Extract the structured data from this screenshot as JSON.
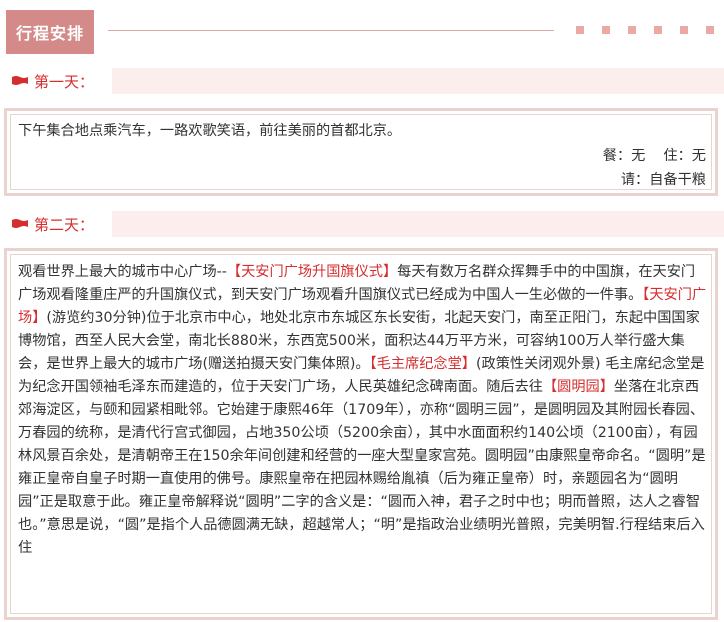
{
  "header": {
    "title": "行程安排"
  },
  "day1": {
    "label": "第一天：",
    "description": "下午集合地点乘汽车，一路欢歌笑语，前往美丽的首都北京。",
    "meals": "餐：无",
    "stay": "住：无",
    "note": "请：自备干粮"
  },
  "day2": {
    "label": "第二天：",
    "segments": [
      {
        "text": "观看世界上最大的城市中心广场--",
        "highlight": false
      },
      {
        "text": "【天安门广场升国旗仪式】",
        "highlight": true
      },
      {
        "text": "每天有数万名群众挥舞手中的中国旗，在天安门广场观看隆重庄严的升国旗仪式，到天安门广场观看升国旗仪式已经成为中国人一生必做的一件事。",
        "highlight": false
      },
      {
        "text": "【天安门广场】",
        "highlight": true
      },
      {
        "text": "(游览约30分钟)位于北京市中心，地处北京市东城区东长安街，北起天安门，南至正阳门，东起中国国家博物馆，西至人民大会堂，南北长880米，东西宽500米，面积达44万平方米，可容纳100万人举行盛大集会，是世界上最大的城市广场(赠送拍摄天安门集体照)。",
        "highlight": false
      },
      {
        "text": "【毛主席纪念堂】",
        "highlight": true
      },
      {
        "text": "(政策性关闭观外景) 毛主席纪念堂是为纪念开国领袖毛泽东而建造的，位于天安门广场，人民英雄纪念碑南面。随后去往",
        "highlight": false
      },
      {
        "text": "【圆明园】",
        "highlight": true
      },
      {
        "text": "坐落在北京西郊海淀区，与颐和园紧相毗邻。它始建于康熙46年（1709年），亦称“圆明三园”，是圆明园及其附园长春园、万春园的统称，是清代行宫式御园，占地350公顷（5200余亩），其中水面面积约140公顷（2100亩），有园林风景百余处，是清朝帝王在150余年间创建和经营的一座大型皇家宫苑。圆明园”由康熙皇帝命名。“圆明”是雍正皇帝自皇子时期一直使用的佛号。康熙皇帝在把园林赐给胤禛（后为雍正皇帝）时，亲题园名为“圆明园”正是取意于此。雍正皇帝解释说“圆明”二字的含义是：“圆而入神，君子之时中也；明而普照，达人之睿智也。”意思是说，“圆”是指个人品德圆满无缺，超越常人；“明”是指政治业绩明光普照，完美明智.行程结束后入住",
        "highlight": false
      }
    ]
  },
  "colors": {
    "badge": "#d38a88",
    "accent_red": "#d42e2e",
    "heading_bar": "#fdeeee",
    "box_border": "#ead3ce"
  },
  "icons": {
    "day_marker": "red-flag-icon"
  }
}
